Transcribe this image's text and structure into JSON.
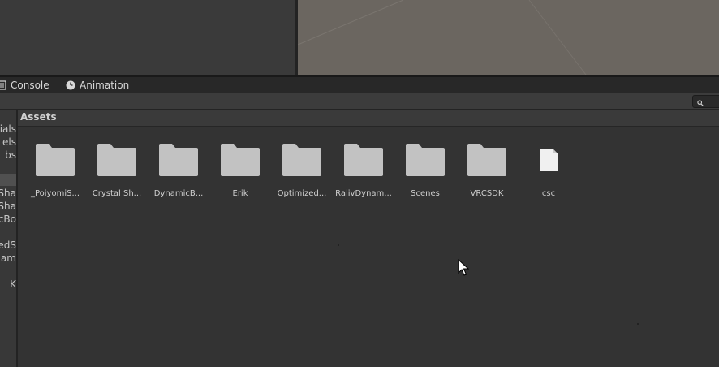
{
  "tabs": [
    {
      "label": "Console",
      "icon": "console-icon"
    },
    {
      "label": "Animation",
      "icon": "clock-icon"
    }
  ],
  "search": {
    "placeholder": "",
    "value": ""
  },
  "breadcrumb": {
    "label": "Assets"
  },
  "sidebar": {
    "items": [
      {
        "label": "rials"
      },
      {
        "label": "els"
      },
      {
        "label": "bs"
      },
      {
        "label": "iSha"
      },
      {
        "label": "Sha"
      },
      {
        "label": "cBo"
      },
      {
        "label": "edS"
      },
      {
        "label": "nam"
      },
      {
        "label": "K"
      }
    ]
  },
  "assets": [
    {
      "label": "_PoiyomiS...",
      "type": "folder"
    },
    {
      "label": "Crystal Sh...",
      "type": "folder"
    },
    {
      "label": "DynamicB...",
      "type": "folder"
    },
    {
      "label": "Erik",
      "type": "folder"
    },
    {
      "label": "Optimized...",
      "type": "folder"
    },
    {
      "label": "RalivDynam...",
      "type": "folder"
    },
    {
      "label": "Scenes",
      "type": "folder"
    },
    {
      "label": "VRCSDK",
      "type": "folder"
    },
    {
      "label": "csc",
      "type": "file"
    }
  ],
  "colors": {
    "background": "#333333",
    "folder": "#c2c2c2",
    "file": "#f0f0f0",
    "scene": "#6b6660"
  }
}
